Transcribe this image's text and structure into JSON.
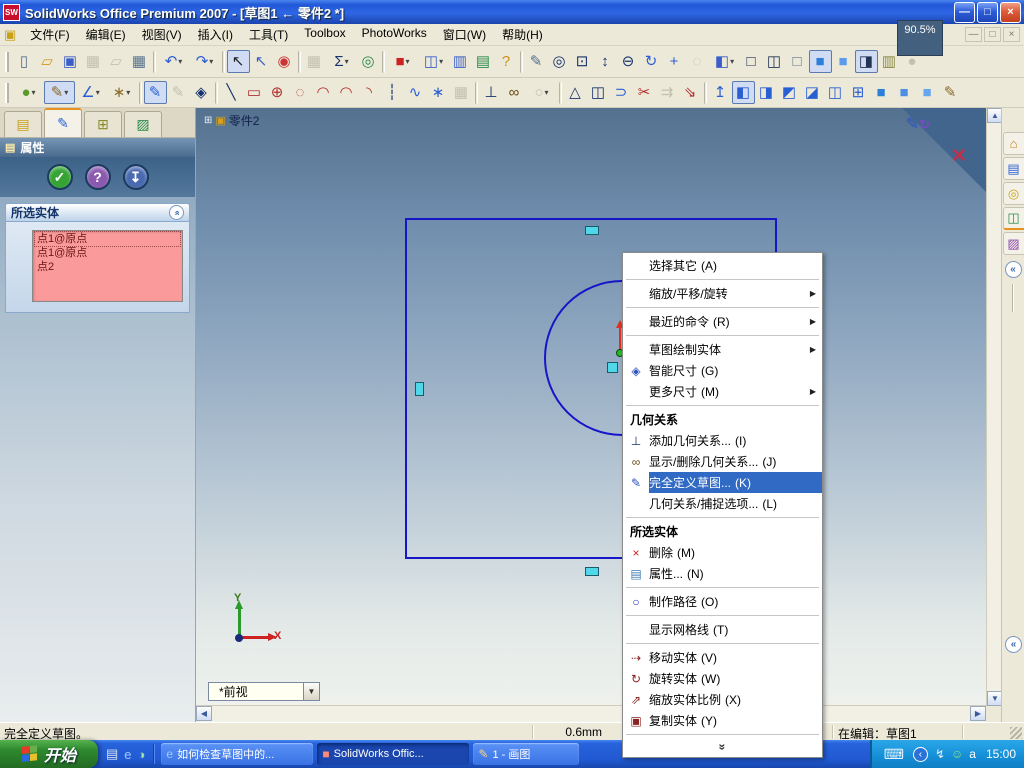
{
  "window": {
    "app_icon": "SW",
    "title": "SolidWorks Office Premium 2007 - [草图1 ← 零件2 *]",
    "zoom_tooltip": "90.5%",
    "buttons": [
      {
        "g": "—",
        "name": "minimize"
      },
      {
        "g": "□",
        "name": "maximize"
      },
      {
        "g": "×",
        "name": "close",
        "close": 1
      }
    ],
    "child_buttons": [
      {
        "g": "—",
        "name": "child-minimize"
      },
      {
        "g": "□",
        "name": "child-restore"
      },
      {
        "g": "×",
        "name": "child-close"
      }
    ]
  },
  "menubar": {
    "items": [
      {
        "label": "文件(F)"
      },
      {
        "label": "编辑(E)"
      },
      {
        "label": "视图(V)"
      },
      {
        "label": "插入(I)"
      },
      {
        "label": "工具(T)"
      },
      {
        "label": "Toolbox"
      },
      {
        "label": "PhotoWorks"
      },
      {
        "label": "窗口(W)"
      },
      {
        "label": "帮助(H)"
      }
    ]
  },
  "toolbar_main": {
    "icons": [
      {
        "g": "▯",
        "c": "#56718c",
        "n": "new-document"
      },
      {
        "g": "▱",
        "c": "#d49a17",
        "n": "open"
      },
      {
        "g": "▣",
        "c": "#3a5fc8",
        "n": "save"
      },
      {
        "g": "▦",
        "c": "#c4c0b0",
        "n": "print-preview"
      },
      {
        "g": "▱",
        "c": "#c4c0b0",
        "n": "edrawings"
      },
      {
        "g": "▦",
        "c": "#56718c",
        "n": "print"
      },
      {
        "sep": 1
      },
      {
        "g": "↶",
        "c": "#2a5fd4",
        "dd": "▾",
        "n": "undo"
      },
      {
        "g": "↷",
        "c": "#2a5fd4",
        "dd": "▾",
        "n": "redo"
      },
      {
        "sep": 1
      },
      {
        "g": "↖",
        "c": "#222222",
        "pressed": 1,
        "n": "select"
      },
      {
        "g": "↖",
        "c": "#3a5fc8",
        "n": "selection-filter"
      },
      {
        "g": "◉",
        "c": "#cc3333",
        "n": "traffic-light"
      },
      {
        "sep": 1
      },
      {
        "g": "▦",
        "c": "#c4c0b0",
        "n": "grid"
      },
      {
        "g": "Σ",
        "c": "#16336e",
        "dd": "▾",
        "n": "measure"
      },
      {
        "g": "◎",
        "c": "#2a8a4a",
        "n": "zoom-selection"
      },
      {
        "sep": 1
      },
      {
        "g": "■",
        "c": "#cc2222",
        "dd": "▾",
        "n": "solidworks-resources"
      },
      {
        "g": "◫",
        "c": "#3a5fc8",
        "dd": "▾",
        "n": "split-panes"
      },
      {
        "g": "▥",
        "c": "#3a5fc8",
        "n": "pane"
      },
      {
        "g": "▤",
        "c": "#2a8a4a",
        "n": "options-list"
      },
      {
        "g": "?",
        "c": "#d09018",
        "n": "help"
      },
      {
        "sep": 1
      },
      {
        "g": "✎",
        "c": "#56718c",
        "n": "stylus"
      },
      {
        "g": "◎",
        "c": "#16336e",
        "n": "zoom-fit"
      },
      {
        "g": "⊡",
        "c": "#16336e",
        "n": "zoom-area"
      },
      {
        "g": "↕",
        "c": "#16336e",
        "n": "zoom-in-out"
      },
      {
        "g": "⊖",
        "c": "#16336e",
        "n": "zoom-out"
      },
      {
        "g": "↻",
        "c": "#2a5fd4",
        "n": "rotate-view"
      },
      {
        "g": "+",
        "c": "#2a5fd4",
        "n": "pan"
      },
      {
        "g": "◌",
        "c": "#c4c0b0",
        "n": "disabled-view"
      },
      {
        "g": "◧",
        "c": "#3a5fc8",
        "dd": "▾",
        "n": "view-orientation"
      },
      {
        "g": "□",
        "c": "#223355",
        "n": "wireframe"
      },
      {
        "g": "◫",
        "c": "#223355",
        "n": "hidden-lines-visible"
      },
      {
        "g": "□",
        "c": "#667788",
        "n": "hidden-lines-removed"
      },
      {
        "g": "■",
        "c": "#2e7fd9",
        "pressed": 1,
        "n": "shaded-with-edges"
      },
      {
        "g": "■",
        "c": "#5a9bee",
        "n": "shaded"
      },
      {
        "g": "◨",
        "c": "#223355",
        "pressed": 1,
        "n": "shadows"
      },
      {
        "g": "▥",
        "c": "#888844",
        "n": "curvature"
      },
      {
        "g": "●",
        "c": "#c4c0b0",
        "n": "disabled-sphere"
      }
    ]
  },
  "toolbar_sketch": {
    "icons": [
      {
        "g": "●",
        "c": "#5a9a2a",
        "dd": "▾",
        "n": "sketch-orb"
      },
      {
        "g": "✎",
        "c": "#8a6a2a",
        "dd": "▾",
        "n": "dimension-pencil",
        "pressed": 1
      },
      {
        "g": "∠",
        "c": "#2a5fd4",
        "dd": "▾",
        "n": "dimension"
      },
      {
        "g": "∗",
        "c": "#8a6a2a",
        "dd": "▾",
        "n": "sketch-settings"
      },
      {
        "sep": 1
      },
      {
        "g": "✎",
        "c": "#2a5fd4",
        "pressed": 1,
        "n": "sketch-active"
      },
      {
        "g": "✎",
        "c": "#c4c0b0",
        "n": "3d-sketch"
      },
      {
        "g": "◈",
        "c": "#16336e",
        "n": "smart-dimension"
      },
      {
        "sep": 1
      },
      {
        "g": "╲",
        "c": "#16336e",
        "n": "line"
      },
      {
        "g": "▭",
        "c": "#b03030",
        "n": "rectangle"
      },
      {
        "g": "⊕",
        "c": "#b03030",
        "n": "circle"
      },
      {
        "g": "◌",
        "c": "#b03030",
        "n": "ellipse"
      },
      {
        "g": "◠",
        "c": "#b03030",
        "n": "centerpoint-arc"
      },
      {
        "g": "◠",
        "c": "#b03030",
        "n": "tangent-arc"
      },
      {
        "g": "◝",
        "c": "#b03030",
        "n": "3point-arc"
      },
      {
        "g": "┆",
        "c": "#16336e",
        "n": "centerline"
      },
      {
        "g": "∿",
        "c": "#2a5fd4",
        "n": "spline"
      },
      {
        "g": "∗",
        "c": "#2a5fd4",
        "n": "point"
      },
      {
        "g": "▦",
        "c": "#c4c0b0",
        "n": "grid-snap"
      },
      {
        "sep": 1
      },
      {
        "g": "⊥",
        "c": "#16336e",
        "n": "add-relation"
      },
      {
        "g": "∞",
        "c": "#6b4b16",
        "n": "display-relations"
      },
      {
        "g": "○",
        "c": "#c4c0b0",
        "dd": "▾",
        "n": "disabled-relation"
      },
      {
        "sep": 1
      },
      {
        "g": "△",
        "c": "#16336e",
        "n": "annotation"
      },
      {
        "g": "◫",
        "c": "#16336e",
        "n": "mirror-entities"
      },
      {
        "g": "⊃",
        "c": "#2a5fd4",
        "n": "offset-entities"
      },
      {
        "g": "✂",
        "c": "#b03030",
        "n": "trim-entities"
      },
      {
        "g": "⇉",
        "c": "#c4c0b0",
        "n": "convert-entities"
      },
      {
        "g": "⇘",
        "c": "#b03030",
        "n": "move-entities"
      },
      {
        "sep": 1
      },
      {
        "g": "↥",
        "c": "#2a5fd4",
        "n": "normal-to"
      },
      {
        "g": "◧",
        "c": "#2a5fd4",
        "pressed": 1,
        "n": "view-front"
      },
      {
        "g": "◨",
        "c": "#2a5fd4",
        "n": "view-back"
      },
      {
        "g": "◩",
        "c": "#2a5fd4",
        "n": "view-left"
      },
      {
        "g": "◪",
        "c": "#2a5fd4",
        "n": "view-right"
      },
      {
        "g": "◫",
        "c": "#2a5fd4",
        "n": "view-top"
      },
      {
        "g": "⊞",
        "c": "#2a5fd4",
        "n": "view-bottom"
      },
      {
        "g": "■",
        "c": "#2e7fd9",
        "n": "view-isometric"
      },
      {
        "g": "■",
        "c": "#4a8fe3",
        "n": "view-trimetric"
      },
      {
        "g": "■",
        "c": "#66a5f0",
        "n": "view-dimetric"
      },
      {
        "g": "✎",
        "c": "#8a6a2a",
        "n": "flashlight"
      }
    ]
  },
  "left_panel": {
    "tabs": [
      {
        "g": "▤",
        "c": "#c8a018",
        "n": "featuremanager-tab"
      },
      {
        "g": "✎",
        "c": "#2a5fd4",
        "active": 1,
        "n": "propertymanager-tab"
      },
      {
        "g": "⊞",
        "c": "#8a8a2a",
        "n": "configurationmanager-tab"
      },
      {
        "g": "▨",
        "c": "#2a8a4a",
        "n": "appearance-tab"
      }
    ],
    "header_icon": "▤",
    "header": "属性",
    "actions": [
      {
        "g": "✓",
        "bg": "#35a435",
        "n": "ok-button"
      },
      {
        "g": "?",
        "bg": "#8a5ab0",
        "n": "help-button"
      },
      {
        "g": "↧",
        "bg": "#4a6ab0",
        "n": "pin-button"
      }
    ],
    "group": {
      "title": "所选实体",
      "collapse_glyph": "»",
      "items": [
        {
          "label": "点1@原点",
          "focused": 1
        },
        {
          "label": "点1@原点"
        },
        {
          "label": "点2"
        }
      ]
    }
  },
  "viewport": {
    "tree": {
      "expander": "⊞",
      "icon": "▣",
      "label": "零件2"
    },
    "confirm_corner": {
      "exit_glyph": "✎",
      "return_glyph": "↻",
      "cancel_glyph": "×"
    },
    "triad": {
      "x_label": "X",
      "y_label": "Y"
    },
    "view_combo": {
      "value": "*前视",
      "arrow": "▼"
    },
    "scroll": {
      "up": "▲",
      "down": "▼",
      "left": "◀",
      "right": "▶"
    }
  },
  "taskpane": {
    "tabs": [
      {
        "g": "⌂",
        "c": "#c88018",
        "n": "sw-resources-tab"
      },
      {
        "g": "▤",
        "c": "#2a5fd4",
        "n": "design-library-tab"
      },
      {
        "g": "◎",
        "c": "#c8a018",
        "n": "file-explorer-tab"
      },
      {
        "g": "◫",
        "c": "#2a8a4a",
        "active": 1,
        "n": "view-palette-tab"
      },
      {
        "g": "▨",
        "c": "#8a4aa8",
        "n": "appearances-tab"
      }
    ],
    "collapse_glyph": "«"
  },
  "context_menu": {
    "items": [
      {
        "label": "选择其它",
        "accel": "(A)"
      },
      {
        "sep": 1
      },
      {
        "label": "缩放/平移/旋转",
        "arrow": "▶"
      },
      {
        "sep": 1
      },
      {
        "label": "最近的命令",
        "accel": "(R)",
        "arrow": "▶"
      },
      {
        "sep": 1
      },
      {
        "label": "草图绘制实体",
        "arrow": "▶"
      },
      {
        "label": "智能尺寸",
        "accel": "(G)",
        "icon": "◈",
        "icon_color": "#2a52be"
      },
      {
        "label": "更多尺寸",
        "accel": "(M)",
        "arrow": "▶"
      },
      {
        "sep": 1
      },
      {
        "header": 1,
        "label": "几何关系"
      },
      {
        "label": "添加几何关系...",
        "accel": "(I)",
        "icon": "⊥",
        "icon_color": "#16336e"
      },
      {
        "label": "显示/删除几何关系...",
        "accel": "(J)",
        "icon": "∞",
        "icon_color": "#6b4b16"
      },
      {
        "label": "完全定义草图...",
        "accel": "(K)",
        "icon": "✎",
        "icon_color": "#2a52be",
        "selected": 1
      },
      {
        "label": "几何关系/捕捉选项...",
        "accel": "(L)"
      },
      {
        "sep": 1
      },
      {
        "header": 1,
        "label": "所选实体"
      },
      {
        "label": "删除",
        "accel": "(M)",
        "icon": "×",
        "icon_color": "#cc2222"
      },
      {
        "label": "属性...",
        "accel": "(N)",
        "icon": "▤",
        "icon_color": "#3c78b4"
      },
      {
        "sep": 1
      },
      {
        "label": "制作路径",
        "accel": "(O)",
        "icon": "○",
        "icon_color": "#2233cc"
      },
      {
        "sep": 1
      },
      {
        "label": "显示网格线",
        "accel": "(T)"
      },
      {
        "sep": 1
      },
      {
        "label": "移动实体",
        "accel": "(V)",
        "icon": "⇢",
        "icon_color": "#8b2222"
      },
      {
        "label": "旋转实体",
        "accel": "(W)",
        "icon": "↻",
        "icon_color": "#8b2222"
      },
      {
        "label": "缩放实体比例",
        "accel": "(X)",
        "icon": "⇗",
        "icon_color": "#8b2222"
      },
      {
        "label": "复制实体",
        "accel": "(Y)",
        "icon": "▣",
        "icon_color": "#8b2222"
      },
      {
        "sep": 1
      },
      {
        "chev": 1,
        "chev_glyph": "»"
      }
    ]
  },
  "status_bar": {
    "left": "完全定义草图。",
    "measure": "0.6mm",
    "edit_state": "在编辑：草图1"
  },
  "taskbar": {
    "start_label": "开始",
    "quick_launch": [
      {
        "g": "▤",
        "c": "#d8e4f0",
        "n": "show-desktop"
      },
      {
        "g": "e",
        "c": "#9ec8ff",
        "n": "internet-explorer"
      },
      {
        "g": "◑",
        "c": "#9ee0a8",
        "n": "media-player"
      }
    ],
    "tasks": [
      {
        "icon": "e",
        "ic": "#9ec8ff",
        "label": "如何检查草图中的...",
        "n": "task-browser"
      },
      {
        "icon": "■",
        "ic": "#ff8a7a",
        "label": "SolidWorks Offic...",
        "active": 1,
        "n": "task-solidworks"
      },
      {
        "icon": "✎",
        "ic": "#ffd27a",
        "label": "1 - 画图",
        "narrow": 1,
        "n": "task-paint"
      }
    ],
    "tray": {
      "keyboard_glyph": "⌨",
      "hide_glyph": "‹",
      "icons": [
        {
          "g": "↯",
          "c": "#e8f0f8",
          "n": "tray-connectivity"
        },
        {
          "g": "☺",
          "c": "#8ae08a",
          "n": "tray-messenger"
        },
        {
          "g": "a",
          "c": "#ffffff",
          "n": "tray-ime"
        }
      ],
      "clock": "15:00"
    }
  }
}
